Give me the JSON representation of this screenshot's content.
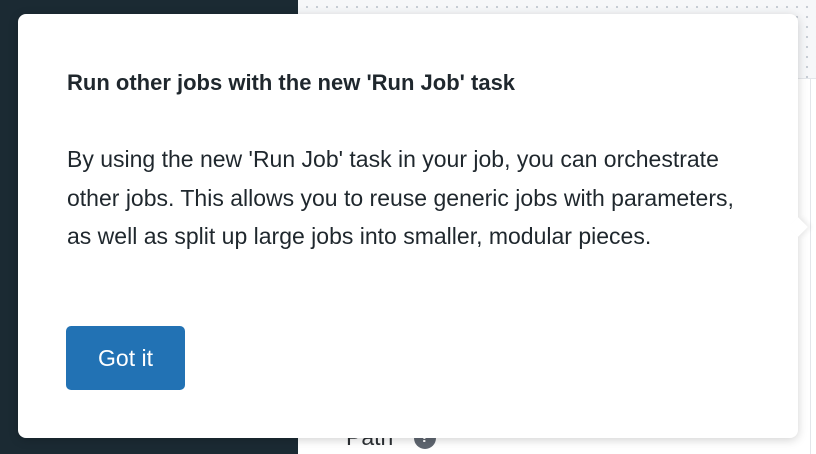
{
  "background": {
    "form": {
      "path_label": "Path",
      "path_required_mark": "*",
      "help_icon": "?"
    }
  },
  "popover": {
    "title": "Run other jobs with the new 'Run Job' task",
    "body": "By using the new 'Run Job' task in your job, you can orchestrate other jobs. This allows you to reuse generic jobs with parameters, as well as split up large jobs into smaller, modular pieces.",
    "dismiss_label": "Got it"
  },
  "colors": {
    "primary_button": "#2272b4",
    "nav_background": "#1b2a33",
    "text": "#1f272d"
  }
}
